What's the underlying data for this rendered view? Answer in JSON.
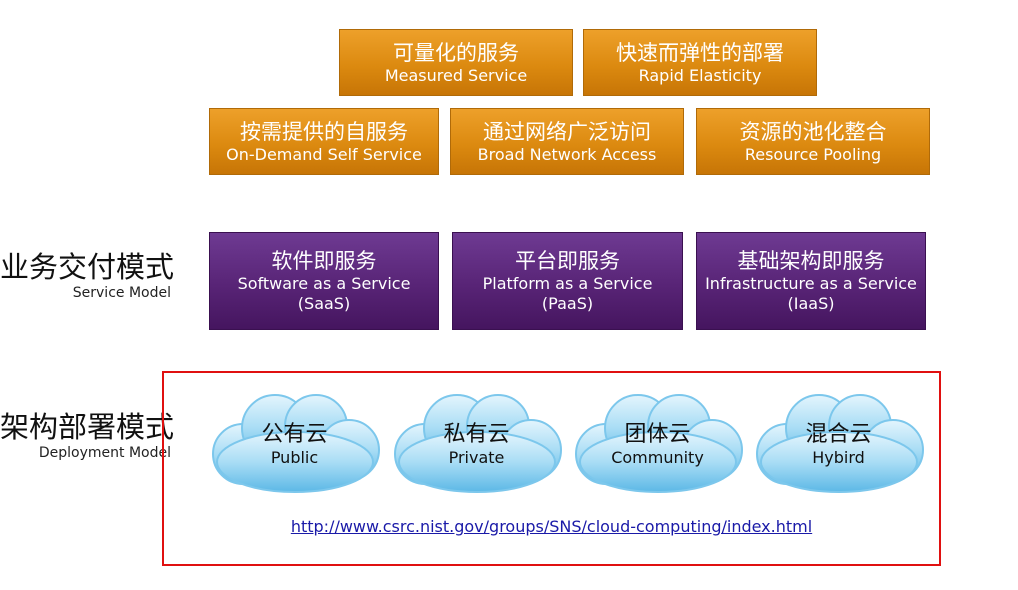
{
  "characteristics": {
    "row1": [
      {
        "zh": "可量化的服务",
        "en": "Measured Service"
      },
      {
        "zh": "快速而弹性的部署",
        "en": "Rapid Elasticity"
      }
    ],
    "row2": [
      {
        "zh": "按需提供的自服务",
        "en": "On-Demand Self Service"
      },
      {
        "zh": "通过网络广泛访问",
        "en": "Broad Network Access"
      },
      {
        "zh": "资源的池化整合",
        "en": "Resource Pooling"
      }
    ]
  },
  "service_model": {
    "label_zh": "业务交付模式",
    "label_en": "Service Model",
    "items": [
      {
        "zh": "软件即服务",
        "en": "Software as a Service",
        "abbr": "(SaaS)"
      },
      {
        "zh": "平台即服务",
        "en": "Platform as a Service",
        "abbr": "(PaaS)"
      },
      {
        "zh": "基础架构即服务",
        "en": "Infrastructure as a Service",
        "abbr": "(IaaS)"
      }
    ]
  },
  "deployment_model": {
    "label_zh": "架构部署模式",
    "label_en": "Deployment Model",
    "items": [
      {
        "zh": "公有云",
        "en": "Public"
      },
      {
        "zh": "私有云",
        "en": "Private"
      },
      {
        "zh": "团体云",
        "en": "Community"
      },
      {
        "zh": "混合云",
        "en": "Hybird"
      }
    ]
  },
  "source_link": "http://www.csrc.nist.gov/groups/SNS/cloud-computing/index.html",
  "colors": {
    "orange": "#dc8a10",
    "purple": "#582476",
    "frame": "#e01010",
    "cloud": "#9fd6f2",
    "link": "#1a1aa8"
  }
}
